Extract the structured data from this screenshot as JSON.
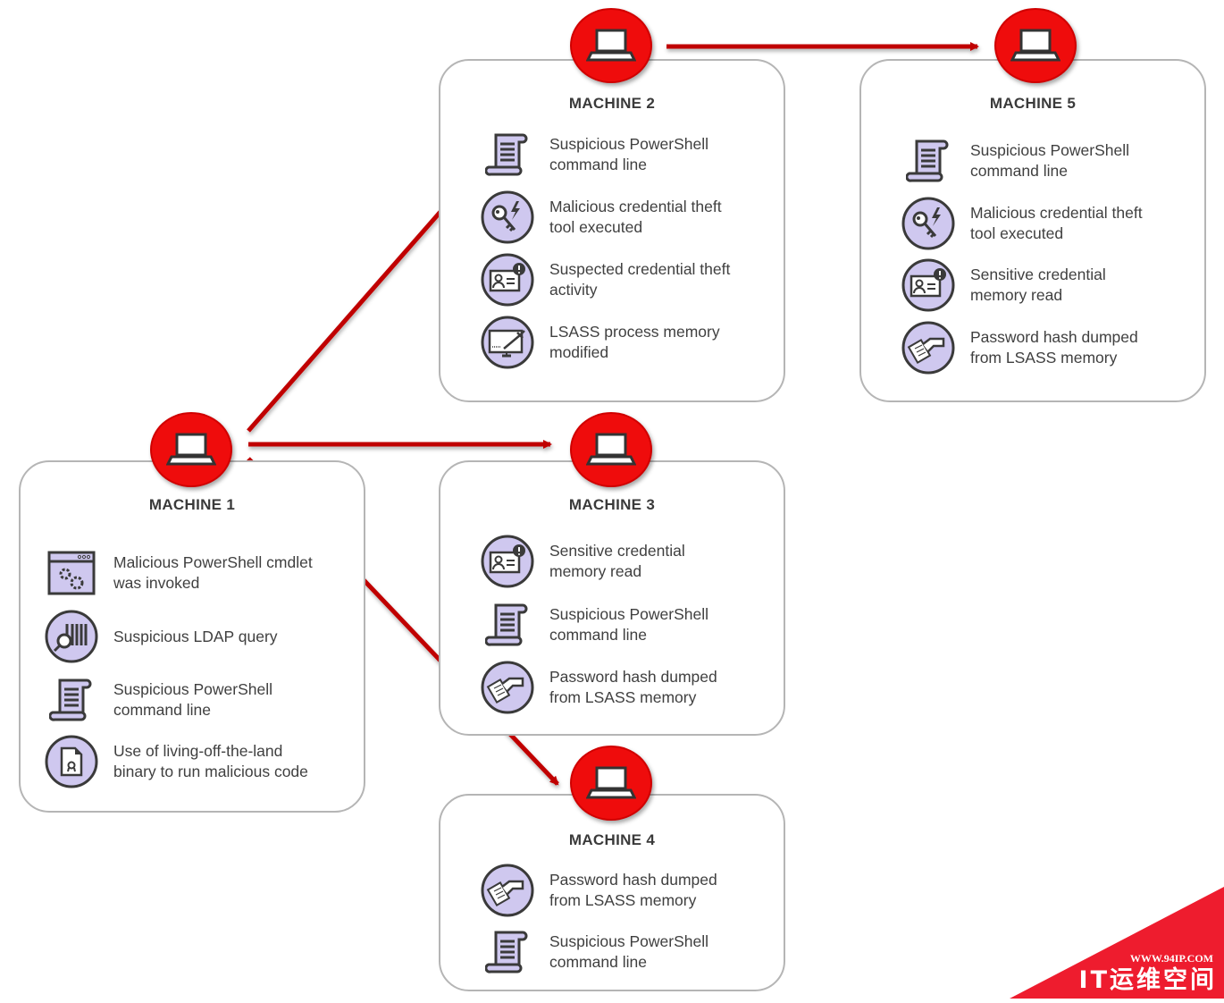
{
  "colors": {
    "accent_red": "#e00000",
    "arrow_red": "#c00000",
    "icon_fill": "#cfc8ef",
    "icon_stroke": "#3a3a3a",
    "card_border": "#b5b5b5"
  },
  "machines": [
    {
      "id": "m1",
      "title": "MACHINE 1",
      "items": [
        {
          "icon": "browser-gears-icon",
          "text": "Malicious PowerShell cmdlet\nwas invoked"
        },
        {
          "icon": "barcode-search-icon",
          "text": "Suspicious LDAP query"
        },
        {
          "icon": "scroll-icon",
          "text": "Suspicious PowerShell\ncommand line"
        },
        {
          "icon": "certificate-file-icon",
          "text": "Use of living-off-the-land\nbinary to run malicious code"
        }
      ]
    },
    {
      "id": "m2",
      "title": "MACHINE 2",
      "items": [
        {
          "icon": "scroll-icon",
          "text": "Suspicious PowerShell\ncommand line"
        },
        {
          "icon": "key-lightning-icon",
          "text": "Malicious credential theft\ntool executed"
        },
        {
          "icon": "id-card-alert-icon",
          "text": "Suspected credential theft\nactivity"
        },
        {
          "icon": "monitor-syringe-icon",
          "text": "LSASS process memory\nmodified"
        }
      ]
    },
    {
      "id": "m3",
      "title": "MACHINE 3",
      "items": [
        {
          "icon": "id-card-alert-icon",
          "text": "Sensitive credential\nmemory read"
        },
        {
          "icon": "scroll-icon",
          "text": "Suspicious PowerShell\ncommand line"
        },
        {
          "icon": "hand-document-icon",
          "text": "Password hash dumped\nfrom LSASS memory"
        }
      ]
    },
    {
      "id": "m4",
      "title": "MACHINE 4",
      "items": [
        {
          "icon": "hand-document-icon",
          "text": "Password hash dumped\nfrom LSASS memory"
        },
        {
          "icon": "scroll-icon",
          "text": "Suspicious PowerShell\ncommand line"
        }
      ]
    },
    {
      "id": "m5",
      "title": "MACHINE 5",
      "items": [
        {
          "icon": "scroll-icon",
          "text": "Suspicious PowerShell\ncommand line"
        },
        {
          "icon": "key-lightning-icon",
          "text": "Malicious credential theft\ntool executed"
        },
        {
          "icon": "id-card-alert-icon",
          "text": "Sensitive credential\nmemory read"
        },
        {
          "icon": "hand-document-icon",
          "text": "Password hash dumped\nfrom LSASS memory"
        }
      ]
    }
  ],
  "edges": [
    {
      "from": "MACHINE 1",
      "to": "MACHINE 2"
    },
    {
      "from": "MACHINE 1",
      "to": "MACHINE 3"
    },
    {
      "from": "MACHINE 1",
      "to": "MACHINE 4"
    },
    {
      "from": "MACHINE 2",
      "to": "MACHINE 5"
    }
  ],
  "watermark": {
    "url": "WWW.94IP.COM",
    "name": "IT运维空间"
  }
}
